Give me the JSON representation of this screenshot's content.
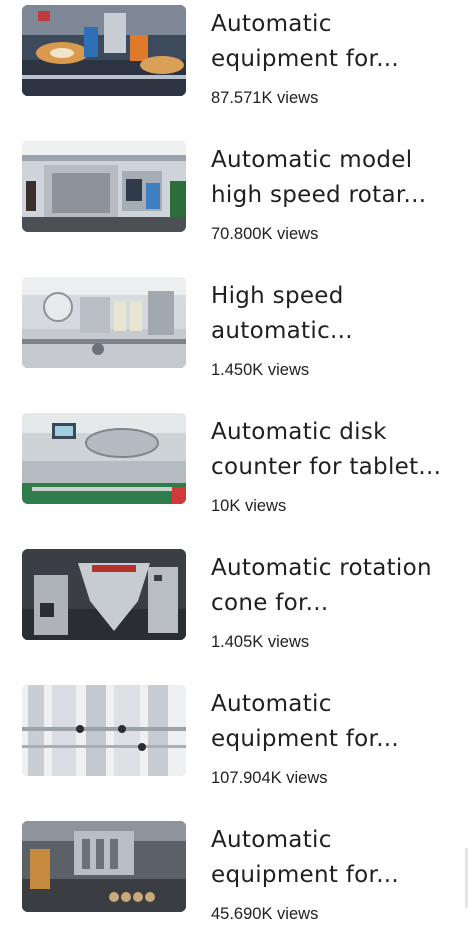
{
  "videos": [
    {
      "title": "Automatic equipment for...",
      "views": "87.571K views",
      "thumb_icon": "packaging-machine-thumbnail"
    },
    {
      "title": "Automatic model high speed rotar...",
      "views": "70.800K views",
      "thumb_icon": "rotary-machine-thumbnail"
    },
    {
      "title": "High speed automatic...",
      "views": "1.450K views",
      "thumb_icon": "labeling-machine-thumbnail"
    },
    {
      "title": "Automatic disk counter for tablet...",
      "views": "10K views",
      "thumb_icon": "tablet-counter-thumbnail"
    },
    {
      "title": "Automatic rotation cone for...",
      "views": "1.405K views",
      "thumb_icon": "cone-mixer-thumbnail"
    },
    {
      "title": "Automatic equipment for...",
      "views": "107.904K views",
      "thumb_icon": "stainless-piping-thumbnail"
    },
    {
      "title": "Automatic equipment for...",
      "views": "45.690K views",
      "thumb_icon": "filling-machine-thumbnail"
    }
  ]
}
